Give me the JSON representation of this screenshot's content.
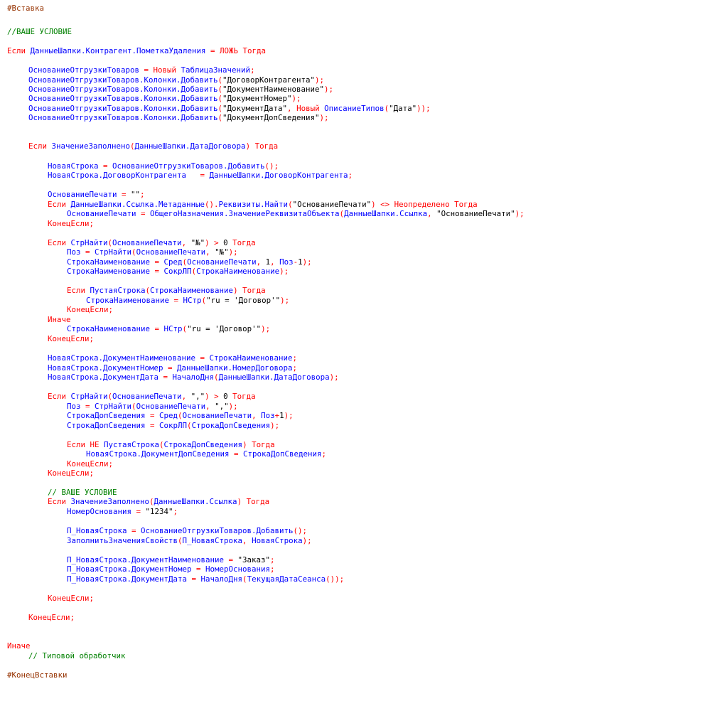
{
  "editor": {
    "colors": {
      "kw": "#ff0000",
      "id": "#0000ff",
      "op": "#ff0000",
      "str": "#000000",
      "num": "#000000",
      "cm": "#008000",
      "pp": "#963200",
      "punct": "#ff0000"
    },
    "lines": [
      {
        "indent": 0,
        "tokens": [
          [
            "pp",
            "#Вставка"
          ]
        ]
      },
      {
        "indent": 0,
        "tokens": [
          [
            "cm",
            "//ВАШЕ УСЛОВИЕ"
          ]
        ]
      },
      {
        "indent": 0,
        "tokens": [
          [
            "kw",
            "Если "
          ],
          [
            "id",
            "ДанныеШапки.Контрагент.ПометкаУдаления"
          ],
          [
            "op",
            " = "
          ],
          [
            "kw",
            "ЛОЖЬ Тогда"
          ]
        ]
      },
      {
        "indent": 1,
        "tokens": [
          [
            "id",
            "ОснованиеОтгрузкиТоваров"
          ],
          [
            "op",
            " = "
          ],
          [
            "kw",
            "Новый "
          ],
          [
            "id",
            "ТаблицаЗначений"
          ],
          [
            "punct",
            ";"
          ]
        ]
      },
      {
        "indent": 1,
        "tokens": [
          [
            "id",
            "ОснованиеОтгрузкиТоваров.Колонки.Добавить"
          ],
          [
            "punct",
            "("
          ],
          [
            "str",
            "\"ДоговорКонтрагента\""
          ],
          [
            "punct",
            ");"
          ]
        ]
      },
      {
        "indent": 1,
        "tokens": [
          [
            "id",
            "ОснованиеОтгрузкиТоваров.Колонки.Добавить"
          ],
          [
            "punct",
            "("
          ],
          [
            "str",
            "\"ДокументНаименование\""
          ],
          [
            "punct",
            ");"
          ]
        ]
      },
      {
        "indent": 1,
        "tokens": [
          [
            "id",
            "ОснованиеОтгрузкиТоваров.Колонки.Добавить"
          ],
          [
            "punct",
            "("
          ],
          [
            "str",
            "\"ДокументНомер\""
          ],
          [
            "punct",
            ");"
          ]
        ]
      },
      {
        "indent": 1,
        "tokens": [
          [
            "id",
            "ОснованиеОтгрузкиТоваров.Колонки.Добавить"
          ],
          [
            "punct",
            "("
          ],
          [
            "str",
            "\"ДокументДата\""
          ],
          [
            "punct",
            ", "
          ],
          [
            "kw",
            "Новый "
          ],
          [
            "id",
            "ОписаниеТипов"
          ],
          [
            "punct",
            "("
          ],
          [
            "str",
            "\"Дата\""
          ],
          [
            "punct",
            "));"
          ]
        ]
      },
      {
        "indent": 1,
        "tokens": [
          [
            "id",
            "ОснованиеОтгрузкиТоваров.Колонки.Добавить"
          ],
          [
            "punct",
            "("
          ],
          [
            "str",
            "\"ДокументДопСведения\""
          ],
          [
            "punct",
            ");"
          ]
        ]
      },
      {
        "indent": 1,
        "tokens": [
          [
            "kw",
            "Если "
          ],
          [
            "id",
            "ЗначениеЗаполнено"
          ],
          [
            "punct",
            "("
          ],
          [
            "id",
            "ДанныеШапки.ДатаДоговора"
          ],
          [
            "punct",
            ") "
          ],
          [
            "kw",
            "Тогда"
          ]
        ]
      },
      {
        "indent": 2,
        "tokens": [
          [
            "id",
            "НоваяСтрока"
          ],
          [
            "op",
            " = "
          ],
          [
            "id",
            "ОснованиеОтгрузкиТоваров.Добавить"
          ],
          [
            "punct",
            "();"
          ]
        ]
      },
      {
        "indent": 2,
        "tokens": [
          [
            "id",
            "НоваяСтрока.ДоговорКонтрагента"
          ],
          [
            "op",
            "   = "
          ],
          [
            "id",
            "ДанныеШапки.ДоговорКонтрагента"
          ],
          [
            "punct",
            ";"
          ]
        ]
      },
      {
        "indent": 2,
        "tokens": [
          [
            "id",
            "ОснованиеПечати"
          ],
          [
            "op",
            " = "
          ],
          [
            "str",
            "\"\""
          ],
          [
            "punct",
            ";"
          ]
        ]
      },
      {
        "indent": 2,
        "tokens": [
          [
            "kw",
            "Если "
          ],
          [
            "id",
            "ДанныеШапки.Ссылка.Метаданные"
          ],
          [
            "punct",
            "()."
          ],
          [
            "id",
            "Реквизиты.Найти"
          ],
          [
            "punct",
            "("
          ],
          [
            "str",
            "\"ОснованиеПечати\""
          ],
          [
            "punct",
            ") "
          ],
          [
            "op",
            "<> "
          ],
          [
            "kw",
            "Неопределено Тогда"
          ]
        ]
      },
      {
        "indent": 3,
        "tokens": [
          [
            "id",
            "ОснованиеПечати"
          ],
          [
            "op",
            " = "
          ],
          [
            "id",
            "ОбщегоНазначения.ЗначениеРеквизитаОбъекта"
          ],
          [
            "punct",
            "("
          ],
          [
            "id",
            "ДанныеШапки.Ссылка"
          ],
          [
            "punct",
            ", "
          ],
          [
            "str",
            "\"ОснованиеПечати\""
          ],
          [
            "punct",
            ");"
          ]
        ]
      },
      {
        "indent": 2,
        "tokens": [
          [
            "kw",
            "КонецЕсли"
          ],
          [
            "punct",
            ";"
          ]
        ]
      },
      {
        "indent": 2,
        "tokens": [
          [
            "kw",
            "Если "
          ],
          [
            "id",
            "СтрНайти"
          ],
          [
            "punct",
            "("
          ],
          [
            "id",
            "ОснованиеПечати"
          ],
          [
            "punct",
            ", "
          ],
          [
            "str",
            "\"№\""
          ],
          [
            "punct",
            ") "
          ],
          [
            "op",
            "> "
          ],
          [
            "num",
            "0"
          ],
          [
            "kw",
            " Тогда"
          ]
        ]
      },
      {
        "indent": 3,
        "tokens": [
          [
            "id",
            "Поз"
          ],
          [
            "op",
            " = "
          ],
          [
            "id",
            "СтрНайти"
          ],
          [
            "punct",
            "("
          ],
          [
            "id",
            "ОснованиеПечати"
          ],
          [
            "punct",
            ", "
          ],
          [
            "str",
            "\"№\""
          ],
          [
            "punct",
            ");"
          ]
        ]
      },
      {
        "indent": 3,
        "tokens": [
          [
            "id",
            "СтрокаНаименование"
          ],
          [
            "op",
            " = "
          ],
          [
            "id",
            "Сред"
          ],
          [
            "punct",
            "("
          ],
          [
            "id",
            "ОснованиеПечати"
          ],
          [
            "punct",
            ", "
          ],
          [
            "num",
            "1"
          ],
          [
            "punct",
            ", "
          ],
          [
            "id",
            "Поз"
          ],
          [
            "op",
            "-"
          ],
          [
            "num",
            "1"
          ],
          [
            "punct",
            ");"
          ]
        ]
      },
      {
        "indent": 3,
        "tokens": [
          [
            "id",
            "СтрокаНаименование"
          ],
          [
            "op",
            " = "
          ],
          [
            "id",
            "СокрЛП"
          ],
          [
            "punct",
            "("
          ],
          [
            "id",
            "СтрокаНаименование"
          ],
          [
            "punct",
            ");"
          ]
        ]
      },
      {
        "indent": 3,
        "tokens": [
          [
            "kw",
            "Если "
          ],
          [
            "id",
            "ПустаяСтрока"
          ],
          [
            "punct",
            "("
          ],
          [
            "id",
            "СтрокаНаименование"
          ],
          [
            "punct",
            ") "
          ],
          [
            "kw",
            "Тогда"
          ]
        ]
      },
      {
        "indent": 4,
        "tokens": [
          [
            "id",
            "СтрокаНаименование"
          ],
          [
            "op",
            " = "
          ],
          [
            "id",
            "НСтр"
          ],
          [
            "punct",
            "("
          ],
          [
            "str",
            "\"ru = 'Договор'\""
          ],
          [
            "punct",
            ");"
          ]
        ]
      },
      {
        "indent": 3,
        "tokens": [
          [
            "kw",
            "КонецЕсли"
          ],
          [
            "punct",
            ";"
          ]
        ]
      },
      {
        "indent": 2,
        "tokens": [
          [
            "kw",
            "Иначе"
          ]
        ]
      },
      {
        "indent": 3,
        "tokens": [
          [
            "id",
            "СтрокаНаименование"
          ],
          [
            "op",
            " = "
          ],
          [
            "id",
            "НСтр"
          ],
          [
            "punct",
            "("
          ],
          [
            "str",
            "\"ru = 'Договор'\""
          ],
          [
            "punct",
            ");"
          ]
        ]
      },
      {
        "indent": 2,
        "tokens": [
          [
            "kw",
            "КонецЕсли"
          ],
          [
            "punct",
            ";"
          ]
        ]
      },
      {
        "indent": 2,
        "tokens": [
          [
            "id",
            "НоваяСтрока.ДокументНаименование"
          ],
          [
            "op",
            " = "
          ],
          [
            "id",
            "СтрокаНаименование"
          ],
          [
            "punct",
            ";"
          ]
        ]
      },
      {
        "indent": 2,
        "tokens": [
          [
            "id",
            "НоваяСтрока.ДокументНомер"
          ],
          [
            "op",
            " = "
          ],
          [
            "id",
            "ДанныеШапки.НомерДоговора"
          ],
          [
            "punct",
            ";"
          ]
        ]
      },
      {
        "indent": 2,
        "tokens": [
          [
            "id",
            "НоваяСтрока.ДокументДата"
          ],
          [
            "op",
            " = "
          ],
          [
            "id",
            "НачалоДня"
          ],
          [
            "punct",
            "("
          ],
          [
            "id",
            "ДанныеШапки.ДатаДоговора"
          ],
          [
            "punct",
            ");"
          ]
        ]
      },
      {
        "indent": 2,
        "tokens": [
          [
            "kw",
            "Если "
          ],
          [
            "id",
            "СтрНайти"
          ],
          [
            "punct",
            "("
          ],
          [
            "id",
            "ОснованиеПечати"
          ],
          [
            "punct",
            ", "
          ],
          [
            "str",
            "\",\""
          ],
          [
            "punct",
            ") "
          ],
          [
            "op",
            "> "
          ],
          [
            "num",
            "0"
          ],
          [
            "kw",
            " Тогда"
          ]
        ]
      },
      {
        "indent": 3,
        "tokens": [
          [
            "id",
            "Поз"
          ],
          [
            "op",
            " = "
          ],
          [
            "id",
            "СтрНайти"
          ],
          [
            "punct",
            "("
          ],
          [
            "id",
            "ОснованиеПечати"
          ],
          [
            "punct",
            ", "
          ],
          [
            "str",
            "\",\""
          ],
          [
            "punct",
            ");"
          ]
        ]
      },
      {
        "indent": 3,
        "tokens": [
          [
            "id",
            "СтрокаДопСведения"
          ],
          [
            "op",
            " = "
          ],
          [
            "id",
            "Сред"
          ],
          [
            "punct",
            "("
          ],
          [
            "id",
            "ОснованиеПечати"
          ],
          [
            "punct",
            ", "
          ],
          [
            "id",
            "Поз"
          ],
          [
            "op",
            "+"
          ],
          [
            "num",
            "1"
          ],
          [
            "punct",
            ");"
          ]
        ]
      },
      {
        "indent": 3,
        "tokens": [
          [
            "id",
            "СтрокаДопСведения"
          ],
          [
            "op",
            " = "
          ],
          [
            "id",
            "СокрЛП"
          ],
          [
            "punct",
            "("
          ],
          [
            "id",
            "СтрокаДопСведения"
          ],
          [
            "punct",
            ");"
          ]
        ]
      },
      {
        "indent": 3,
        "tokens": [
          [
            "kw",
            "Если НЕ "
          ],
          [
            "id",
            "ПустаяСтрока"
          ],
          [
            "punct",
            "("
          ],
          [
            "id",
            "СтрокаДопСведения"
          ],
          [
            "punct",
            ") "
          ],
          [
            "kw",
            "Тогда"
          ]
        ]
      },
      {
        "indent": 4,
        "tokens": [
          [
            "id",
            "НоваяСтрока.ДокументДопСведения"
          ],
          [
            "op",
            " = "
          ],
          [
            "id",
            "СтрокаДопСведения"
          ],
          [
            "punct",
            ";"
          ]
        ]
      },
      {
        "indent": 3,
        "tokens": [
          [
            "kw",
            "КонецЕсли"
          ],
          [
            "punct",
            ";"
          ]
        ]
      },
      {
        "indent": 2,
        "tokens": [
          [
            "kw",
            "КонецЕсли"
          ],
          [
            "punct",
            ";"
          ]
        ]
      },
      {
        "indent": 2,
        "tokens": [
          [
            "cm",
            "// ВАШЕ УСЛОВИЕ"
          ]
        ]
      },
      {
        "indent": 2,
        "tokens": [
          [
            "kw",
            "Если "
          ],
          [
            "id",
            "ЗначениеЗаполнено"
          ],
          [
            "punct",
            "("
          ],
          [
            "id",
            "ДанныеШапки.Ссылка"
          ],
          [
            "punct",
            ") "
          ],
          [
            "kw",
            "Тогда"
          ]
        ]
      },
      {
        "indent": 3,
        "tokens": [
          [
            "id",
            "НомерОснования"
          ],
          [
            "op",
            " = "
          ],
          [
            "str",
            "\"1234\""
          ],
          [
            "punct",
            ";"
          ]
        ]
      },
      {
        "indent": 3,
        "tokens": [
          [
            "id",
            "П_НоваяСтрока"
          ],
          [
            "op",
            " = "
          ],
          [
            "id",
            "ОснованиеОтгрузкиТоваров.Добавить"
          ],
          [
            "punct",
            "();"
          ]
        ]
      },
      {
        "indent": 3,
        "tokens": [
          [
            "id",
            "ЗаполнитьЗначенияСвойств"
          ],
          [
            "punct",
            "("
          ],
          [
            "id",
            "П_НоваяСтрока"
          ],
          [
            "punct",
            ", "
          ],
          [
            "id",
            "НоваяСтрока"
          ],
          [
            "punct",
            ");"
          ]
        ]
      },
      {
        "indent": 3,
        "tokens": [
          [
            "id",
            "П_НоваяСтрока.ДокументНаименование"
          ],
          [
            "op",
            " = "
          ],
          [
            "str",
            "\"Заказ\""
          ],
          [
            "punct",
            ";"
          ]
        ]
      },
      {
        "indent": 3,
        "tokens": [
          [
            "id",
            "П_НоваяСтрока.ДокументНомер"
          ],
          [
            "op",
            " = "
          ],
          [
            "id",
            "НомерОснования"
          ],
          [
            "punct",
            ";"
          ]
        ]
      },
      {
        "indent": 3,
        "tokens": [
          [
            "id",
            "П_НоваяСтрока.ДокументДата"
          ],
          [
            "op",
            " = "
          ],
          [
            "id",
            "НачалоДня"
          ],
          [
            "punct",
            "("
          ],
          [
            "id",
            "ТекущаяДатаСеанса"
          ],
          [
            "punct",
            "());"
          ]
        ]
      },
      {
        "indent": 2,
        "tokens": [
          [
            "kw",
            "КонецЕсли"
          ],
          [
            "punct",
            ";"
          ]
        ]
      },
      {
        "indent": 1,
        "tokens": [
          [
            "kw",
            "КонецЕсли"
          ],
          [
            "punct",
            ";"
          ]
        ]
      },
      {
        "indent": 0,
        "tokens": [
          [
            "kw",
            "Иначе"
          ]
        ]
      },
      {
        "indent": 1,
        "tokens": [
          [
            "cm",
            "// Типовой обработчик"
          ]
        ]
      },
      {
        "indent": 0,
        "tokens": [
          [
            "pp",
            "#КонецВставки"
          ]
        ]
      }
    ]
  }
}
